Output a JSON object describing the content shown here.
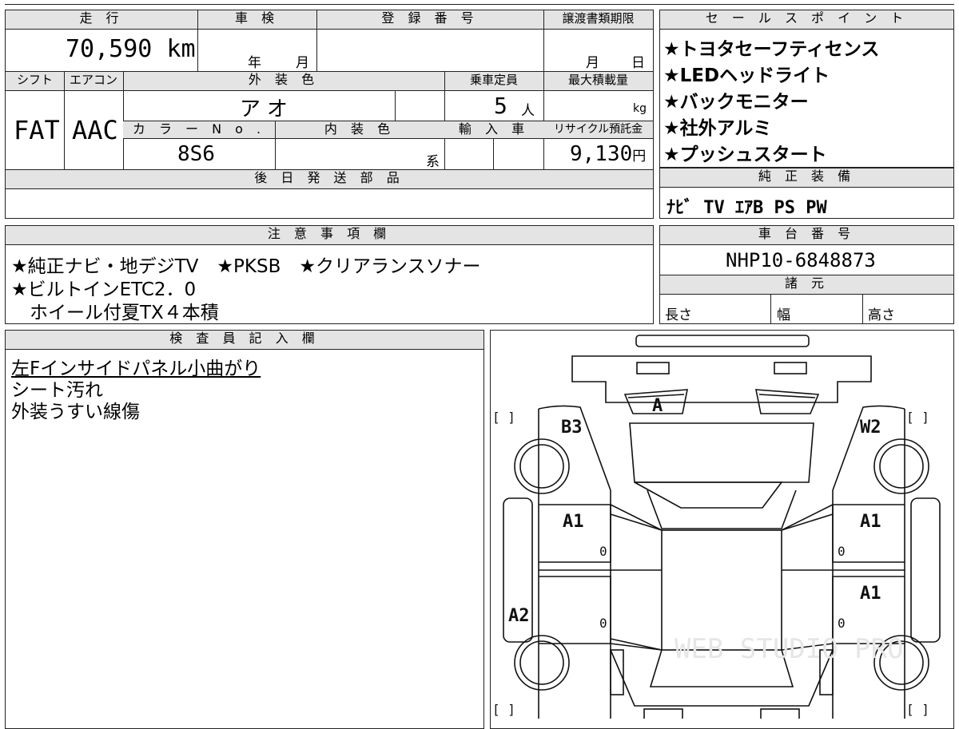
{
  "headers": {
    "mileage": "走 行",
    "inspection": "車 検",
    "registration": "登 録 番 号",
    "transfer_deadline": "譲渡書類期限",
    "sales_points": "セ ー ル ス ポ イ ン ト",
    "shift": "シフト",
    "aircon": "エアコン",
    "exterior_color": "外 装 色",
    "capacity": "乗車定員",
    "max_load": "最大積載量",
    "color_no": "カ ラ ー N o .",
    "interior_color": "内 装 色",
    "import": "輸 入 車",
    "recycle": "リサイクル預託金",
    "later_parts": "後 日 発 送 部 品",
    "genuine_equipment": "純 正 装 備",
    "notes": "注 意 事 項 欄",
    "chassis_number": "車 台 番 号",
    "specs": "諸 元",
    "inspector": "検 査 員 記 入 欄"
  },
  "values": {
    "mileage": "70,590",
    "mileage_unit": "km",
    "year_label": "年",
    "month_label": "月",
    "deadline_month": "月",
    "deadline_day": "日",
    "shift": "FAT",
    "aircon": "AAC",
    "exterior_color": "アオ",
    "capacity": "5",
    "capacity_unit": "人",
    "max_load_unit": "kg",
    "color_no": "8S6",
    "interior_suffix": "系",
    "recycle": "9,130",
    "recycle_unit": "円",
    "genuine_equipment": "ﾅﾋﾞ TV ｴｱB PS PW",
    "chassis_number": "NHP10-6848873",
    "length_label": "長さ",
    "width_label": "幅",
    "height_label": "高さ"
  },
  "sales_points": [
    "★トヨタセーフティセンス",
    "★LEDヘッドライト",
    "★バックモニター",
    "★社外アルミ",
    "★プッシュスタート"
  ],
  "notes": [
    "★純正ナビ・地デジTV　★PKSB　★クリアランスソナー",
    "★ビルトインETC2．0",
    "　ホイール付夏TX４本積"
  ],
  "inspector_notes": [
    "左Fインサイドパネル小曲がり",
    "シート汚れ",
    "外装うすい線傷"
  ],
  "diagram": {
    "marks": {
      "front_glass": "A",
      "left_front": "B3",
      "right_front": "W2",
      "left_front_door": "A1",
      "right_front_door": "A1",
      "right_rear_door": "A1",
      "left_rear_side": "A2",
      "door_zero_1": "0",
      "door_zero_2": "0",
      "door_zero_3": "0",
      "door_zero_4": "0"
    },
    "brackets": "[        ]",
    "watermark": "WEB STUDIO PRO"
  }
}
